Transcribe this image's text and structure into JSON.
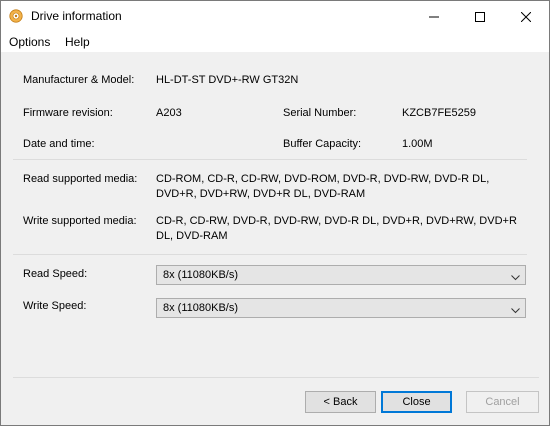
{
  "window": {
    "title": "Drive information",
    "icon": "cd-disc-icon",
    "controls": {
      "minimize": "minimize-icon",
      "maximize": "maximize-icon",
      "close": "close-icon"
    }
  },
  "menu": {
    "options": "Options",
    "help": "Help"
  },
  "info": {
    "manufacturer_label": "Manufacturer & Model:",
    "manufacturer_value": "HL-DT-ST DVD+-RW GT32N",
    "firmware_label": "Firmware revision:",
    "firmware_value": "A203",
    "serial_label": "Serial Number:",
    "serial_value": "KZCB7FE5259",
    "datetime_label": "Date and time:",
    "datetime_value": "",
    "buffer_label": "Buffer Capacity:",
    "buffer_value": "1.00M",
    "read_media_label": "Read supported media:",
    "read_media_value": "CD-ROM, CD-R, CD-RW, DVD-ROM, DVD-R, DVD-RW, DVD-R DL, DVD+R, DVD+RW, DVD+R DL, DVD-RAM",
    "write_media_label": "Write supported media:",
    "write_media_value": "CD-R, CD-RW, DVD-R, DVD-RW, DVD-R DL, DVD+R, DVD+RW, DVD+R DL, DVD-RAM"
  },
  "speeds": {
    "read_label": "Read Speed:",
    "read_value": "8x (11080KB/s)",
    "write_label": "Write Speed:",
    "write_value": "8x (11080KB/s)"
  },
  "buttons": {
    "back": "< Back",
    "close": "Close",
    "cancel": "Cancel"
  }
}
